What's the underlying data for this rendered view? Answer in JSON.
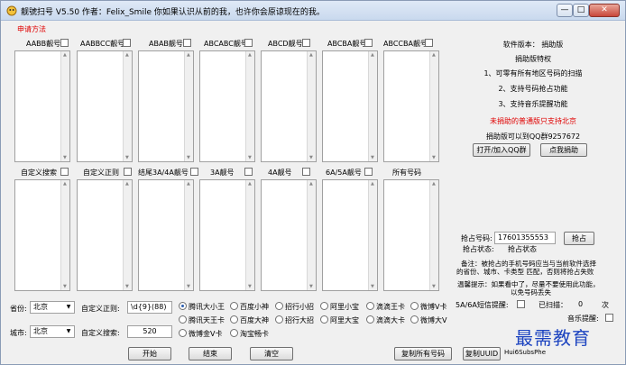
{
  "window": {
    "title": "靓號扫号 V5.50   作者：Felix_Smile          你如果认识从前的我，也许你会原谅现在的我。",
    "min": "—",
    "max": "□",
    "close": "✕"
  },
  "apply_link": "申请方法",
  "top_lists": [
    "AABB靓号",
    "AABBCC靓号",
    "ABAB靓号",
    "ABCABC靓号",
    "ABCD靓号",
    "ABCBA靓号",
    "ABCCBA靓号"
  ],
  "bottom_lists": [
    "自定义搜索",
    "自定义正则",
    "结尾3A/4A靓号",
    "3A靓号",
    "4A靓号",
    "6A/5A靓号",
    "所有号码"
  ],
  "info": {
    "version": "软件版本：  捐助版",
    "privilege_title": "捐助版特权",
    "item1": "1、可零有所有地区号码的扫描",
    "item2": "2、支持号码抢占功能",
    "item3": "3、支持音乐提醒功能",
    "warning": "未捐助的普通版只支持北京",
    "contact": "捐助版可以到QQ群9257672",
    "btn_join": "打开/加入QQ群",
    "btn_donate": "点我捐助"
  },
  "grab": {
    "number_label": "抢占号码:",
    "number_value": "17601355553",
    "grab_button": "抢占",
    "status_label": "抢占状态:",
    "status_value": "抢占状态",
    "note1": "备注：被抢占的手机号码应当与当前软件选择",
    "note2": "的省份、城市、卡类型 匹配，否则将抢占失败",
    "hint1": "温馨提示：如果看中了，尽量不要使用此功能，",
    "hint2": "以免号码丢失",
    "sms_label": "5A/6A短信提醒:",
    "scanned_label": "已扫描：",
    "scanned_value": "0",
    "scanned_unit": "次",
    "music_label": "音乐提醒:"
  },
  "form": {
    "province_label": "省份:",
    "province_value": "北京",
    "city_label": "城市:",
    "city_value": "北京",
    "regex_label": "自定义正则:",
    "regex_value": "\\d{9}(88)",
    "search_label": "自定义搜索:",
    "search_value": "520"
  },
  "radios_row1": [
    "腾讯大小王",
    "百度小神",
    "招行小招",
    "阿里小宝",
    "滴滴王卡",
    "微博V卡"
  ],
  "radios_row2": [
    "腾讯天王卡",
    "百度大神",
    "招行大招",
    "阿里大宝",
    "滴滴大卡",
    "微博大V"
  ],
  "radios_row3": [
    "微博金V卡",
    "淘宝畅卡"
  ],
  "buttons": {
    "start": "开始",
    "stop": "结束",
    "clear": "清空",
    "copy_all": "复制所有号码",
    "copy_uuid": "复制UUID",
    "uuid_text": "Hui6SubsPhe"
  },
  "watermark": "最需教育"
}
